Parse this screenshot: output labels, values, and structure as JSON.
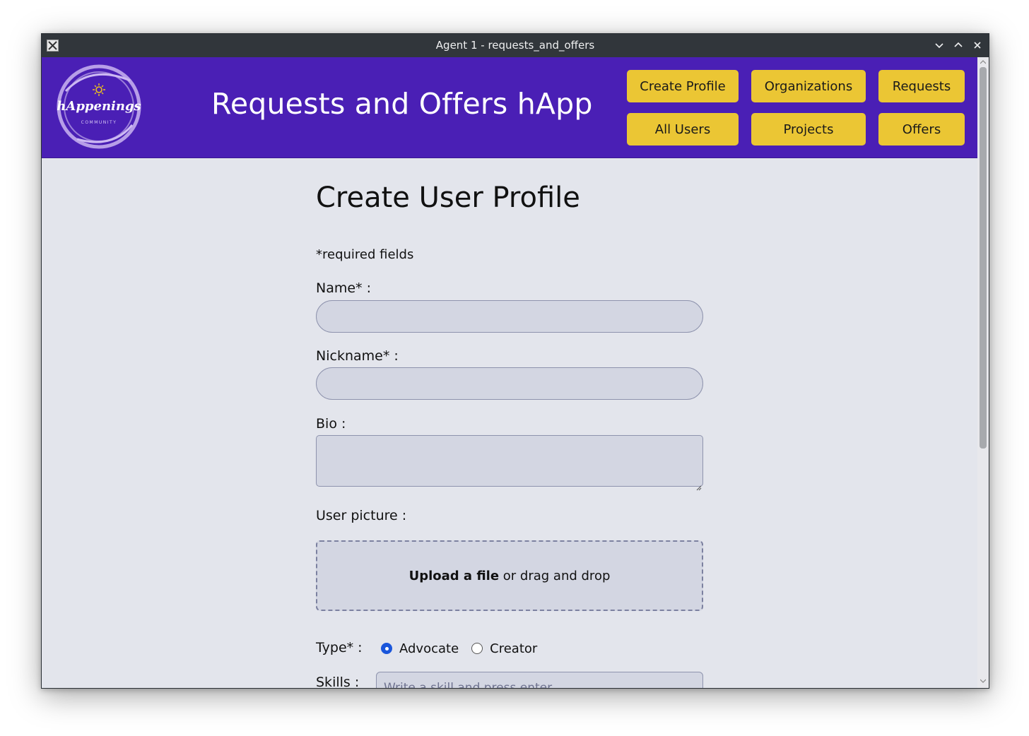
{
  "window": {
    "title": "Agent 1 - requests_and_offers"
  },
  "header": {
    "logo_text": "hAppenings",
    "logo_subtext": "COMMUNITY",
    "app_title": "Requests and Offers hApp",
    "brand_color": "#4a1fb5",
    "button_color": "#ebc634",
    "nav": {
      "create_profile": "Create Profile",
      "organizations": "Organizations",
      "requests": "Requests",
      "all_users": "All Users",
      "projects": "Projects",
      "offers": "Offers"
    }
  },
  "form": {
    "title": "Create User Profile",
    "required_note": "*required fields",
    "name_label": "Name* :",
    "name_value": "",
    "nickname_label": "Nickname* :",
    "nickname_value": "",
    "bio_label": "Bio :",
    "bio_value": "",
    "picture_label": "User picture :",
    "upload_link": "Upload a file",
    "upload_rest": " or drag and drop",
    "type_label": "Type* :",
    "type_options": [
      {
        "label": "Advocate",
        "selected": true
      },
      {
        "label": "Creator",
        "selected": false
      }
    ],
    "skills_label": "Skills :",
    "skills_placeholder": "Write a skill and press enter"
  }
}
